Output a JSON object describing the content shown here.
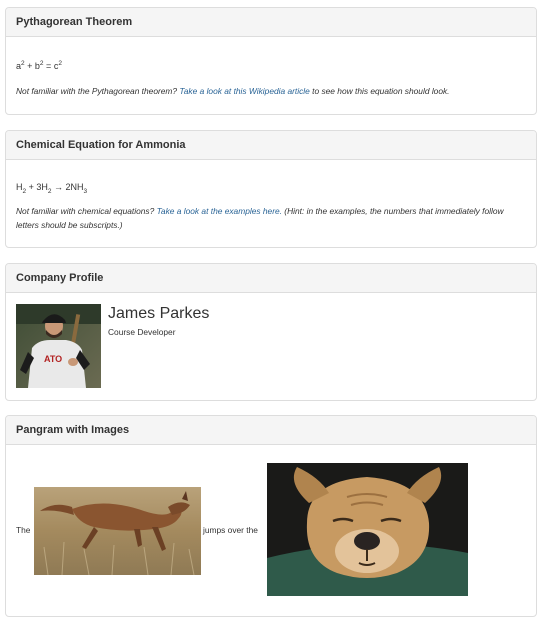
{
  "panels": {
    "pythagorean": {
      "title": "Pythagorean Theorem",
      "equation": {
        "a": "a",
        "two": "2",
        "plus": " + ",
        "b": "b",
        "eq": " = ",
        "c": "c"
      },
      "note_pre": "Not familiar with the Pythagorean theorem? ",
      "note_link": "Take a look at this Wikipedia article",
      "note_post": " to see how this equation should look."
    },
    "ammonia": {
      "title": "Chemical Equation for Ammonia",
      "equation": {
        "h": "H",
        "two": "2",
        "plus": " + 3H",
        "arrow": " → 2NH",
        "three": "3"
      },
      "note_pre": "Not familiar with chemical equations? ",
      "note_link": "Take a look at the examples here.",
      "note_post": " (Hint: in the examples, the numbers that immediately follow letters should be subscripts.)"
    },
    "profile": {
      "title": "Company Profile",
      "name": "James Parkes",
      "role": "Course Developer",
      "avatar_jersey_text": "ATO"
    },
    "pangram": {
      "title": "Pangram with Images",
      "word_the": "The",
      "phrase_jumps": "jumps over the"
    }
  },
  "colors": {
    "link": "#2a6496",
    "heading_bg": "#f5f5f5",
    "border": "#dddddd"
  },
  "icons": {
    "fox": "fox-image",
    "dog": "dog-image",
    "avatar": "person-photo"
  }
}
